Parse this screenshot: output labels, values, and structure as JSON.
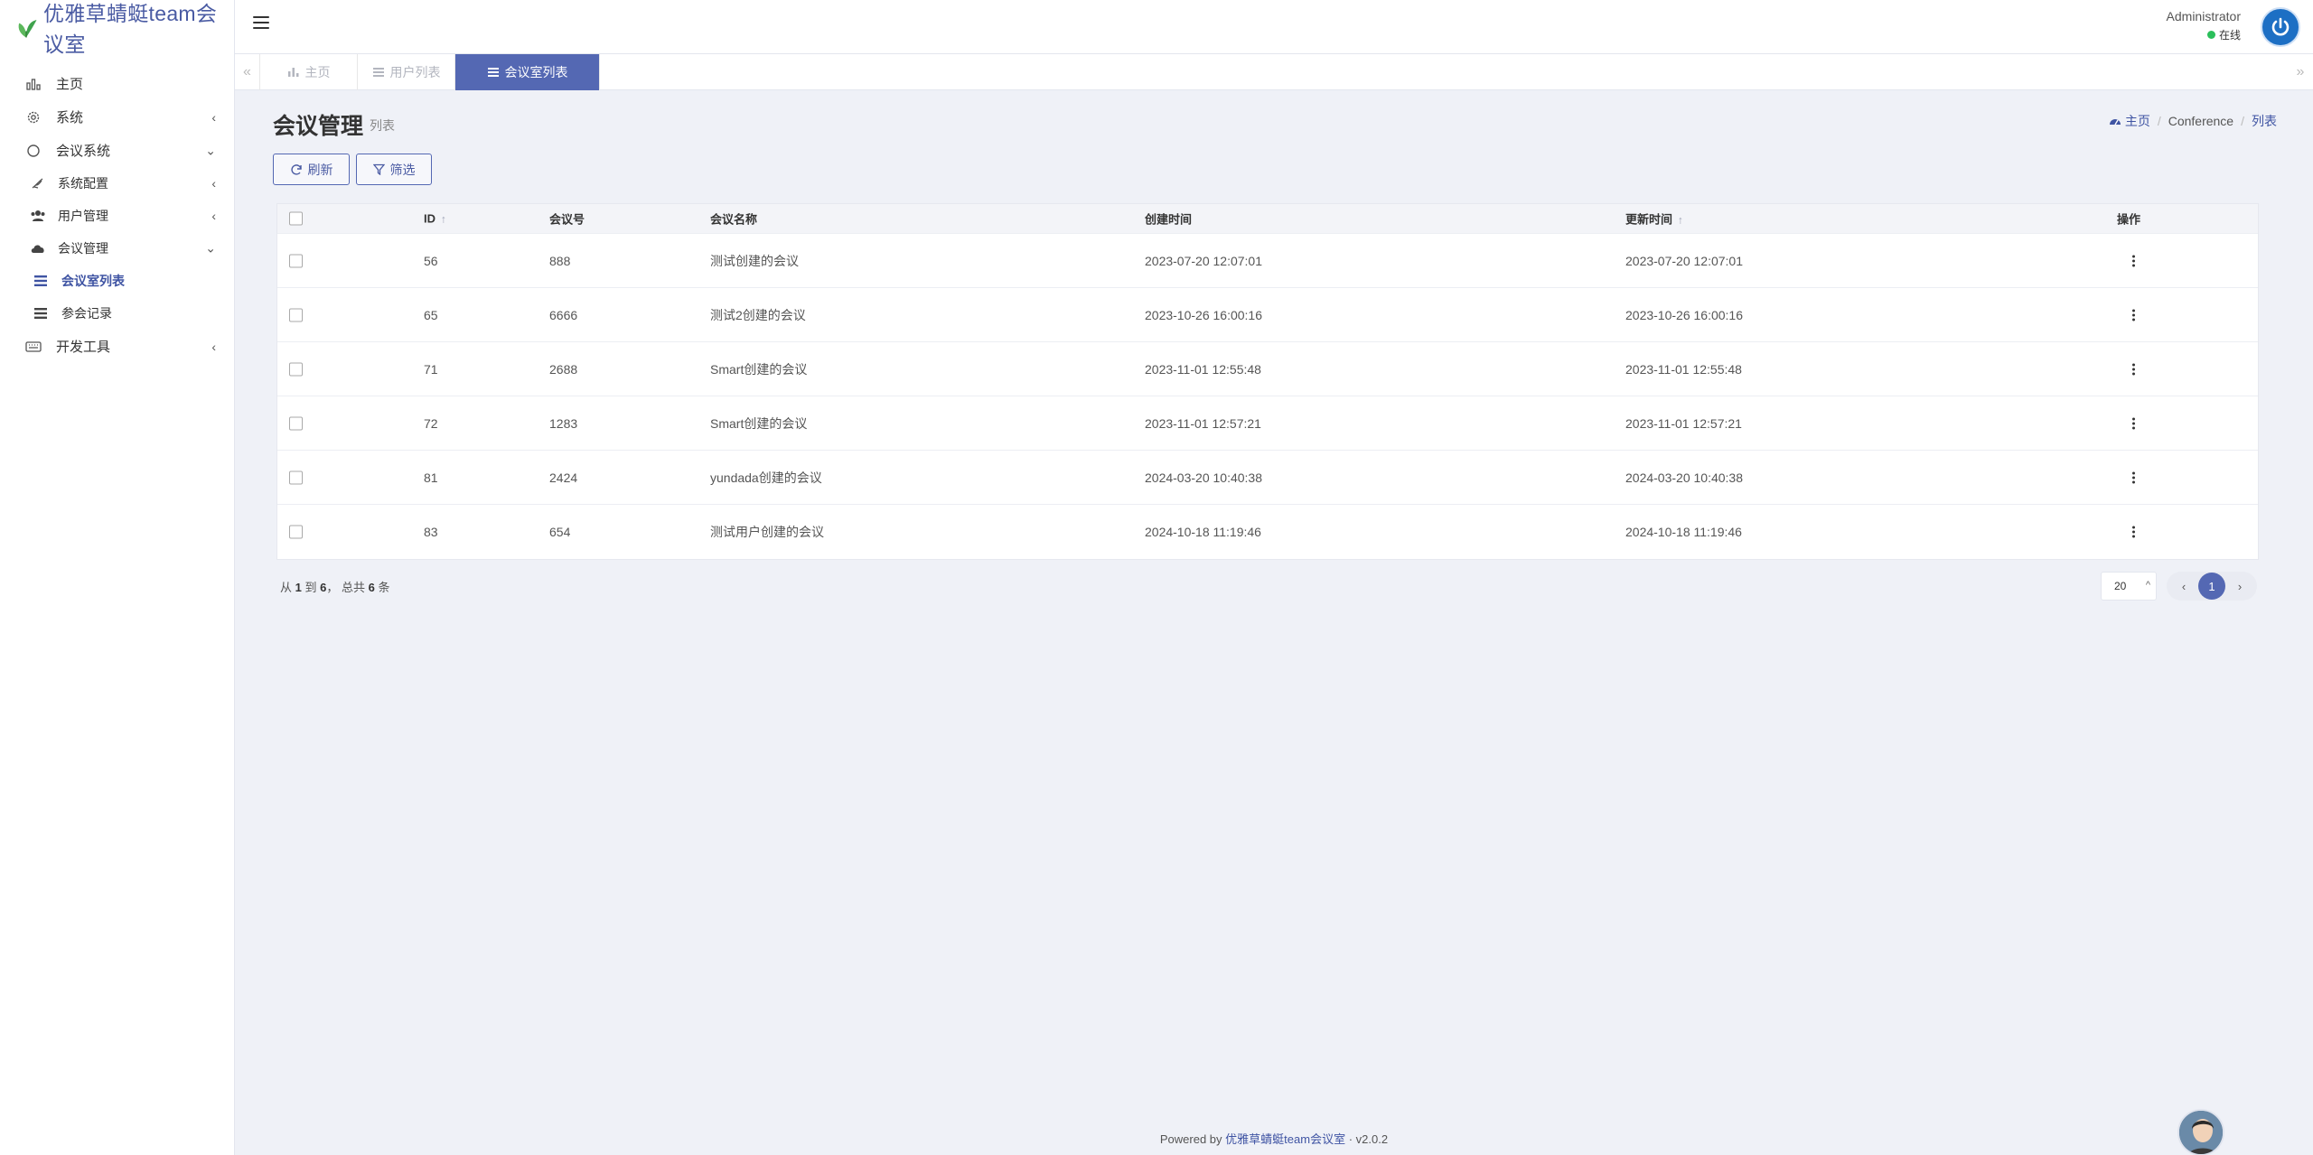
{
  "brand": {
    "name": "优雅草蜻蜓team会议室"
  },
  "sidebar": {
    "items": [
      {
        "label": "主页",
        "icon": "bar-chart-icon"
      },
      {
        "label": "系统",
        "icon": "gear-icon"
      },
      {
        "label": "会议系统",
        "icon": "circle-icon"
      },
      {
        "label": "系统配置",
        "icon": "bird-icon"
      },
      {
        "label": "用户管理",
        "icon": "users-icon"
      },
      {
        "label": "会议管理",
        "icon": "cloud-icon"
      },
      {
        "label": "会议室列表",
        "icon": "list-icon"
      },
      {
        "label": "参会记录",
        "icon": "list-icon"
      },
      {
        "label": "开发工具",
        "icon": "keyboard-icon"
      }
    ]
  },
  "header": {
    "user_name": "Administrator",
    "user_status": "在线"
  },
  "tabs": [
    {
      "label": "主页"
    },
    {
      "label": "用户列表"
    },
    {
      "label": "会议室列表"
    }
  ],
  "page": {
    "title": "会议管理",
    "subtitle": "列表",
    "breadcrumb": {
      "home": "主页",
      "section": "Conference",
      "current": "列表"
    }
  },
  "toolbar": {
    "refresh": "刷新",
    "filter": "筛选"
  },
  "table": {
    "columns": [
      "ID",
      "会议号",
      "会议名称",
      "创建时间",
      "更新时间",
      "操作"
    ],
    "rows": [
      {
        "id": "56",
        "number": "888",
        "name": "测试创建的会议",
        "created": "2023-07-20 12:07:01",
        "updated": "2023-07-20 12:07:01"
      },
      {
        "id": "65",
        "number": "6666",
        "name": "测试2创建的会议",
        "created": "2023-10-26 16:00:16",
        "updated": "2023-10-26 16:00:16"
      },
      {
        "id": "71",
        "number": "2688",
        "name": "Smart创建的会议",
        "created": "2023-11-01 12:55:48",
        "updated": "2023-11-01 12:55:48"
      },
      {
        "id": "72",
        "number": "1283",
        "name": "Smart创建的会议",
        "created": "2023-11-01 12:57:21",
        "updated": "2023-11-01 12:57:21"
      },
      {
        "id": "81",
        "number": "2424",
        "name": "yundada创建的会议",
        "created": "2024-03-20 10:40:38",
        "updated": "2024-03-20 10:40:38"
      },
      {
        "id": "83",
        "number": "654",
        "name": "测试用户创建的会议",
        "created": "2024-10-18 11:19:46",
        "updated": "2024-10-18 11:19:46"
      }
    ]
  },
  "pagination": {
    "summary_prefix": "从",
    "from": "1",
    "to_word": "到",
    "to": "6",
    "total_prefix": "， 总共",
    "total": "6",
    "unit": "条",
    "page_size": "20",
    "current_page": "1"
  },
  "footer": {
    "prefix": "Powered by",
    "brand": "优雅草蜻蜓team会议室",
    "separator": "·",
    "version": "v2.0.2"
  },
  "colors": {
    "accent": "#5468b3",
    "online": "#2bbf5b",
    "background": "#eff1f7"
  }
}
